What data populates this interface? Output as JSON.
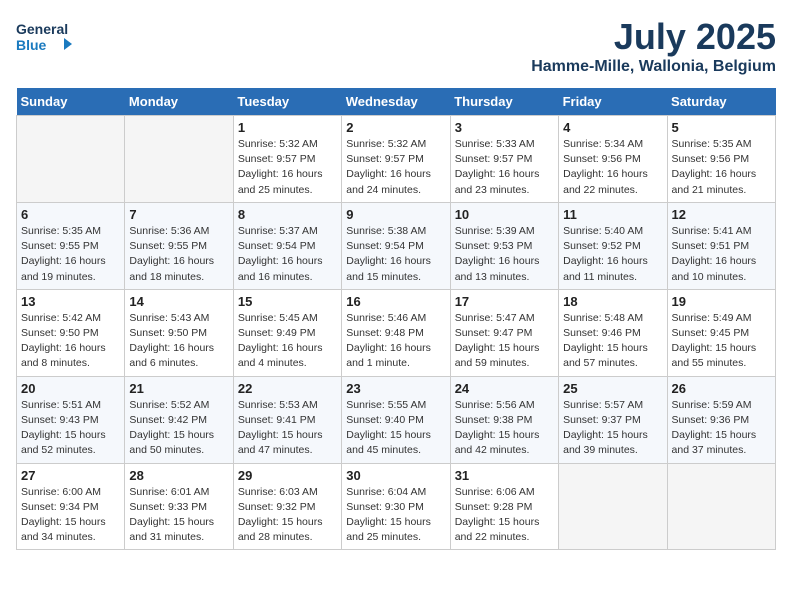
{
  "header": {
    "logo_line1": "General",
    "logo_line2": "Blue",
    "month_year": "July 2025",
    "location": "Hamme-Mille, Wallonia, Belgium"
  },
  "days_of_week": [
    "Sunday",
    "Monday",
    "Tuesday",
    "Wednesday",
    "Thursday",
    "Friday",
    "Saturday"
  ],
  "weeks": [
    [
      {
        "day": "",
        "info": ""
      },
      {
        "day": "",
        "info": ""
      },
      {
        "day": "1",
        "info": "Sunrise: 5:32 AM\nSunset: 9:57 PM\nDaylight: 16 hours\nand 25 minutes."
      },
      {
        "day": "2",
        "info": "Sunrise: 5:32 AM\nSunset: 9:57 PM\nDaylight: 16 hours\nand 24 minutes."
      },
      {
        "day": "3",
        "info": "Sunrise: 5:33 AM\nSunset: 9:57 PM\nDaylight: 16 hours\nand 23 minutes."
      },
      {
        "day": "4",
        "info": "Sunrise: 5:34 AM\nSunset: 9:56 PM\nDaylight: 16 hours\nand 22 minutes."
      },
      {
        "day": "5",
        "info": "Sunrise: 5:35 AM\nSunset: 9:56 PM\nDaylight: 16 hours\nand 21 minutes."
      }
    ],
    [
      {
        "day": "6",
        "info": "Sunrise: 5:35 AM\nSunset: 9:55 PM\nDaylight: 16 hours\nand 19 minutes."
      },
      {
        "day": "7",
        "info": "Sunrise: 5:36 AM\nSunset: 9:55 PM\nDaylight: 16 hours\nand 18 minutes."
      },
      {
        "day": "8",
        "info": "Sunrise: 5:37 AM\nSunset: 9:54 PM\nDaylight: 16 hours\nand 16 minutes."
      },
      {
        "day": "9",
        "info": "Sunrise: 5:38 AM\nSunset: 9:54 PM\nDaylight: 16 hours\nand 15 minutes."
      },
      {
        "day": "10",
        "info": "Sunrise: 5:39 AM\nSunset: 9:53 PM\nDaylight: 16 hours\nand 13 minutes."
      },
      {
        "day": "11",
        "info": "Sunrise: 5:40 AM\nSunset: 9:52 PM\nDaylight: 16 hours\nand 11 minutes."
      },
      {
        "day": "12",
        "info": "Sunrise: 5:41 AM\nSunset: 9:51 PM\nDaylight: 16 hours\nand 10 minutes."
      }
    ],
    [
      {
        "day": "13",
        "info": "Sunrise: 5:42 AM\nSunset: 9:50 PM\nDaylight: 16 hours\nand 8 minutes."
      },
      {
        "day": "14",
        "info": "Sunrise: 5:43 AM\nSunset: 9:50 PM\nDaylight: 16 hours\nand 6 minutes."
      },
      {
        "day": "15",
        "info": "Sunrise: 5:45 AM\nSunset: 9:49 PM\nDaylight: 16 hours\nand 4 minutes."
      },
      {
        "day": "16",
        "info": "Sunrise: 5:46 AM\nSunset: 9:48 PM\nDaylight: 16 hours\nand 1 minute."
      },
      {
        "day": "17",
        "info": "Sunrise: 5:47 AM\nSunset: 9:47 PM\nDaylight: 15 hours\nand 59 minutes."
      },
      {
        "day": "18",
        "info": "Sunrise: 5:48 AM\nSunset: 9:46 PM\nDaylight: 15 hours\nand 57 minutes."
      },
      {
        "day": "19",
        "info": "Sunrise: 5:49 AM\nSunset: 9:45 PM\nDaylight: 15 hours\nand 55 minutes."
      }
    ],
    [
      {
        "day": "20",
        "info": "Sunrise: 5:51 AM\nSunset: 9:43 PM\nDaylight: 15 hours\nand 52 minutes."
      },
      {
        "day": "21",
        "info": "Sunrise: 5:52 AM\nSunset: 9:42 PM\nDaylight: 15 hours\nand 50 minutes."
      },
      {
        "day": "22",
        "info": "Sunrise: 5:53 AM\nSunset: 9:41 PM\nDaylight: 15 hours\nand 47 minutes."
      },
      {
        "day": "23",
        "info": "Sunrise: 5:55 AM\nSunset: 9:40 PM\nDaylight: 15 hours\nand 45 minutes."
      },
      {
        "day": "24",
        "info": "Sunrise: 5:56 AM\nSunset: 9:38 PM\nDaylight: 15 hours\nand 42 minutes."
      },
      {
        "day": "25",
        "info": "Sunrise: 5:57 AM\nSunset: 9:37 PM\nDaylight: 15 hours\nand 39 minutes."
      },
      {
        "day": "26",
        "info": "Sunrise: 5:59 AM\nSunset: 9:36 PM\nDaylight: 15 hours\nand 37 minutes."
      }
    ],
    [
      {
        "day": "27",
        "info": "Sunrise: 6:00 AM\nSunset: 9:34 PM\nDaylight: 15 hours\nand 34 minutes."
      },
      {
        "day": "28",
        "info": "Sunrise: 6:01 AM\nSunset: 9:33 PM\nDaylight: 15 hours\nand 31 minutes."
      },
      {
        "day": "29",
        "info": "Sunrise: 6:03 AM\nSunset: 9:32 PM\nDaylight: 15 hours\nand 28 minutes."
      },
      {
        "day": "30",
        "info": "Sunrise: 6:04 AM\nSunset: 9:30 PM\nDaylight: 15 hours\nand 25 minutes."
      },
      {
        "day": "31",
        "info": "Sunrise: 6:06 AM\nSunset: 9:28 PM\nDaylight: 15 hours\nand 22 minutes."
      },
      {
        "day": "",
        "info": ""
      },
      {
        "day": "",
        "info": ""
      }
    ]
  ]
}
